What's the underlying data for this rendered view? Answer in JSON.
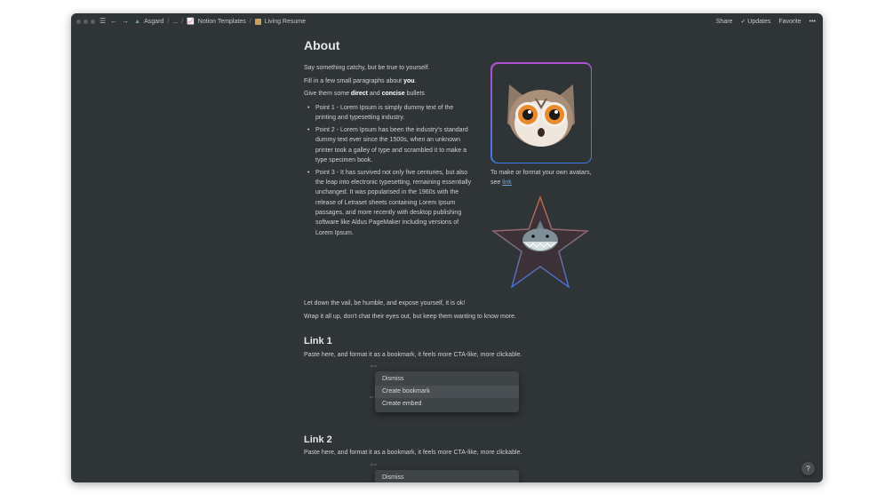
{
  "window": {
    "breadcrumb": [
      "Asgard",
      "...",
      "Notion Templates",
      "Living Resume"
    ],
    "actions": {
      "share": "Share",
      "updates": "Updates",
      "favorite": "Favorite",
      "more": "•••"
    }
  },
  "page": {
    "heading": "About",
    "intro": {
      "line1": "Say something catchy, but be true to yourself.",
      "line2_pre": "Fill in a few small paragraphs about ",
      "line2_bold": "you",
      "line2_post": ".",
      "line3_pre": "Give them some ",
      "line3_bold1": "direct",
      "line3_mid": " and ",
      "line3_bold2": "concise",
      "line3_post": " bullets"
    },
    "bullets": [
      "Point 1 - Lorem Ipsum is simply dummy text of the printing and typesetting industry.",
      "Point 2 - Lorem Ipsum has been the industry's standard dummy text ever since the 1500s, when an unknown printer took a galley of type and scrambled it to make a type specimen book.",
      "Point 3 - It has survived not only five centuries, but also the leap into electronic typesetting, remaining essentially unchanged. It was popularised in the 1960s with the release of Letraset sheets containing Lorem Ipsum passages, and more recently with desktop publishing software like Aldus PageMaker including versions of Lorem Ipsum."
    ],
    "avatar_caption": "To make or format your own avatars, see ",
    "avatar_link": "link",
    "after1": "Let down the vail, be humble, and expose yourself, it is ok!",
    "after2": "Wrap it all up, don't chat their eyes out, but keep them wanting to know more.",
    "link1": {
      "heading": "Link 1",
      "text": "Paste here, and format it as a bookmark, it feels more CTA-like, more clickable.",
      "menu": [
        "Dismiss",
        "Create bookmark",
        "Create embed"
      ]
    },
    "link2": {
      "heading": "Link 2",
      "text": "Paste here, and format it as a bookmark, it feels more CTA-like, more clickable.",
      "menu": [
        "Dismiss"
      ]
    }
  },
  "help": "?"
}
